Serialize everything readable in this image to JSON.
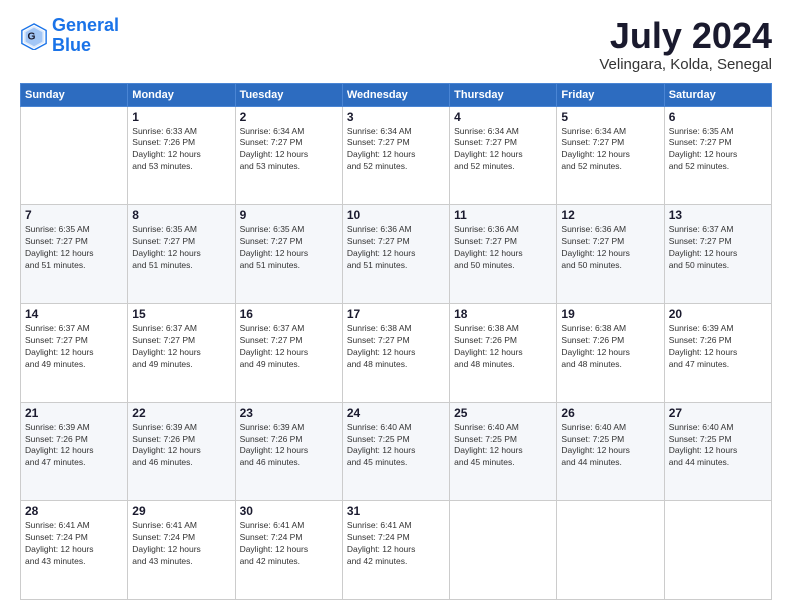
{
  "logo": {
    "line1": "General",
    "line2": "Blue"
  },
  "title": "July 2024",
  "location": "Velingara, Kolda, Senegal",
  "days_of_week": [
    "Sunday",
    "Monday",
    "Tuesday",
    "Wednesday",
    "Thursday",
    "Friday",
    "Saturday"
  ],
  "weeks": [
    [
      {
        "day": "",
        "info": ""
      },
      {
        "day": "1",
        "info": "Sunrise: 6:33 AM\nSunset: 7:26 PM\nDaylight: 12 hours\nand 53 minutes."
      },
      {
        "day": "2",
        "info": "Sunrise: 6:34 AM\nSunset: 7:27 PM\nDaylight: 12 hours\nand 53 minutes."
      },
      {
        "day": "3",
        "info": "Sunrise: 6:34 AM\nSunset: 7:27 PM\nDaylight: 12 hours\nand 52 minutes."
      },
      {
        "day": "4",
        "info": "Sunrise: 6:34 AM\nSunset: 7:27 PM\nDaylight: 12 hours\nand 52 minutes."
      },
      {
        "day": "5",
        "info": "Sunrise: 6:34 AM\nSunset: 7:27 PM\nDaylight: 12 hours\nand 52 minutes."
      },
      {
        "day": "6",
        "info": "Sunrise: 6:35 AM\nSunset: 7:27 PM\nDaylight: 12 hours\nand 52 minutes."
      }
    ],
    [
      {
        "day": "7",
        "info": "Sunrise: 6:35 AM\nSunset: 7:27 PM\nDaylight: 12 hours\nand 51 minutes."
      },
      {
        "day": "8",
        "info": "Sunrise: 6:35 AM\nSunset: 7:27 PM\nDaylight: 12 hours\nand 51 minutes."
      },
      {
        "day": "9",
        "info": "Sunrise: 6:35 AM\nSunset: 7:27 PM\nDaylight: 12 hours\nand 51 minutes."
      },
      {
        "day": "10",
        "info": "Sunrise: 6:36 AM\nSunset: 7:27 PM\nDaylight: 12 hours\nand 51 minutes."
      },
      {
        "day": "11",
        "info": "Sunrise: 6:36 AM\nSunset: 7:27 PM\nDaylight: 12 hours\nand 50 minutes."
      },
      {
        "day": "12",
        "info": "Sunrise: 6:36 AM\nSunset: 7:27 PM\nDaylight: 12 hours\nand 50 minutes."
      },
      {
        "day": "13",
        "info": "Sunrise: 6:37 AM\nSunset: 7:27 PM\nDaylight: 12 hours\nand 50 minutes."
      }
    ],
    [
      {
        "day": "14",
        "info": "Sunrise: 6:37 AM\nSunset: 7:27 PM\nDaylight: 12 hours\nand 49 minutes."
      },
      {
        "day": "15",
        "info": "Sunrise: 6:37 AM\nSunset: 7:27 PM\nDaylight: 12 hours\nand 49 minutes."
      },
      {
        "day": "16",
        "info": "Sunrise: 6:37 AM\nSunset: 7:27 PM\nDaylight: 12 hours\nand 49 minutes."
      },
      {
        "day": "17",
        "info": "Sunrise: 6:38 AM\nSunset: 7:27 PM\nDaylight: 12 hours\nand 48 minutes."
      },
      {
        "day": "18",
        "info": "Sunrise: 6:38 AM\nSunset: 7:26 PM\nDaylight: 12 hours\nand 48 minutes."
      },
      {
        "day": "19",
        "info": "Sunrise: 6:38 AM\nSunset: 7:26 PM\nDaylight: 12 hours\nand 48 minutes."
      },
      {
        "day": "20",
        "info": "Sunrise: 6:39 AM\nSunset: 7:26 PM\nDaylight: 12 hours\nand 47 minutes."
      }
    ],
    [
      {
        "day": "21",
        "info": "Sunrise: 6:39 AM\nSunset: 7:26 PM\nDaylight: 12 hours\nand 47 minutes."
      },
      {
        "day": "22",
        "info": "Sunrise: 6:39 AM\nSunset: 7:26 PM\nDaylight: 12 hours\nand 46 minutes."
      },
      {
        "day": "23",
        "info": "Sunrise: 6:39 AM\nSunset: 7:26 PM\nDaylight: 12 hours\nand 46 minutes."
      },
      {
        "day": "24",
        "info": "Sunrise: 6:40 AM\nSunset: 7:25 PM\nDaylight: 12 hours\nand 45 minutes."
      },
      {
        "day": "25",
        "info": "Sunrise: 6:40 AM\nSunset: 7:25 PM\nDaylight: 12 hours\nand 45 minutes."
      },
      {
        "day": "26",
        "info": "Sunrise: 6:40 AM\nSunset: 7:25 PM\nDaylight: 12 hours\nand 44 minutes."
      },
      {
        "day": "27",
        "info": "Sunrise: 6:40 AM\nSunset: 7:25 PM\nDaylight: 12 hours\nand 44 minutes."
      }
    ],
    [
      {
        "day": "28",
        "info": "Sunrise: 6:41 AM\nSunset: 7:24 PM\nDaylight: 12 hours\nand 43 minutes."
      },
      {
        "day": "29",
        "info": "Sunrise: 6:41 AM\nSunset: 7:24 PM\nDaylight: 12 hours\nand 43 minutes."
      },
      {
        "day": "30",
        "info": "Sunrise: 6:41 AM\nSunset: 7:24 PM\nDaylight: 12 hours\nand 42 minutes."
      },
      {
        "day": "31",
        "info": "Sunrise: 6:41 AM\nSunset: 7:24 PM\nDaylight: 12 hours\nand 42 minutes."
      },
      {
        "day": "",
        "info": ""
      },
      {
        "day": "",
        "info": ""
      },
      {
        "day": "",
        "info": ""
      }
    ]
  ]
}
